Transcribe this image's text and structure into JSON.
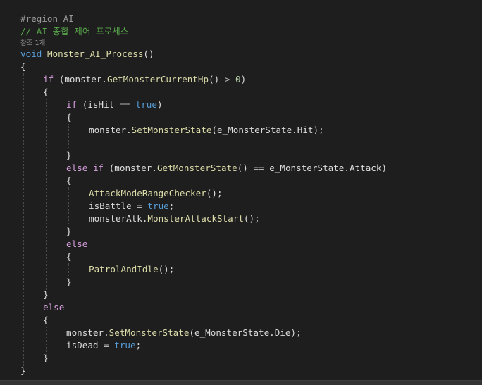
{
  "code": {
    "region": "#region AI",
    "comment": "// AI 종합 제어 프로세스",
    "references": "참조 1개",
    "signature": {
      "kw_void": "void",
      "name": "Monster_AI_Process",
      "parens": "()"
    },
    "l_brace": "{",
    "r_brace": "}",
    "if_outer": {
      "kw_if": "if",
      "open": " (",
      "obj": "monster",
      "dot": ".",
      "method": "GetMonsterCurrentHp",
      "call": "()",
      "op": " > ",
      "num": "0",
      "close": ")"
    },
    "if_hit": {
      "kw_if": "if",
      "open": " (",
      "var": "isHit",
      "op": " == ",
      "val": "true",
      "close": ")"
    },
    "set_hit": {
      "obj": "monster",
      "dot": ".",
      "method": "SetMonsterState",
      "open": "(",
      "enum_type": "e_MonsterState",
      "dot2": ".",
      "enum_val": "Hit",
      "close": ");"
    },
    "else_if_attack": {
      "kw_else": "else",
      "kw_if": "if",
      "open": " (",
      "obj": "monster",
      "dot": ".",
      "method": "GetMonsterState",
      "call": "()",
      "op": " == ",
      "enum_type": "e_MonsterState",
      "dot2": ".",
      "enum_val": "Attack",
      "close": ")"
    },
    "range_checker": {
      "method": "AttackModeRangeChecker",
      "call": "();"
    },
    "is_battle": {
      "var": "isBattle",
      "op": " = ",
      "val": "true",
      "end": ";"
    },
    "attack_start": {
      "obj": "monsterAtk",
      "dot": ".",
      "method": "MonsterAttackStart",
      "call": "();"
    },
    "else_kw": "else",
    "patrol": {
      "method": "PatrolAndIdle",
      "call": "();"
    },
    "set_die": {
      "obj": "monster",
      "dot": ".",
      "method": "SetMonsterState",
      "open": "(",
      "enum_type": "e_MonsterState",
      "dot2": ".",
      "enum_val": "Die",
      "close": ");"
    },
    "is_dead": {
      "var": "isDead",
      "op": " = ",
      "val": "true",
      "end": ";"
    }
  },
  "colors": {
    "background": "#1e1e1e",
    "keyword": "#569cd6",
    "control_keyword": "#d8a0df",
    "method": "#dcdcaa",
    "comment": "#57a64a",
    "enum_member": "#b8d7a3",
    "enum_type": "#4ec9b0",
    "preprocessor": "#9b9b9b",
    "number": "#b5cea8",
    "codelens": "#999999"
  }
}
